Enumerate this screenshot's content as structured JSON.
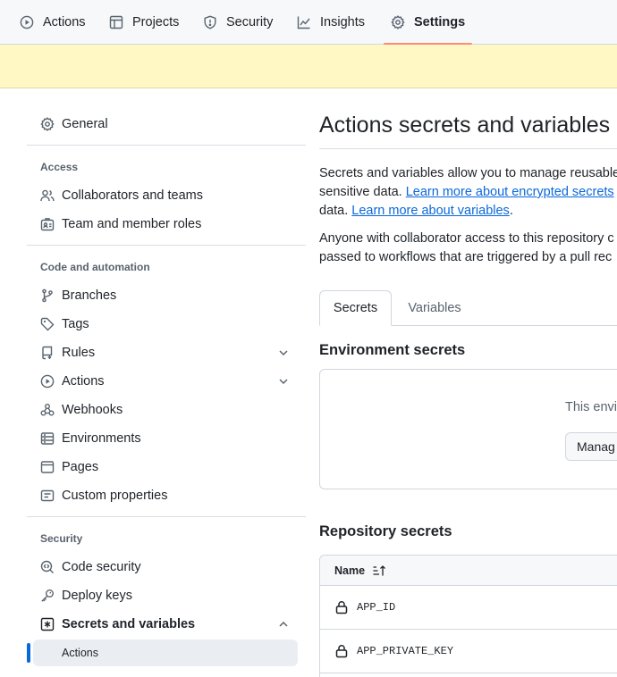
{
  "topnav": {
    "tabs": [
      {
        "label": "Actions",
        "icon": "play-icon"
      },
      {
        "label": "Projects",
        "icon": "table-icon"
      },
      {
        "label": "Security",
        "icon": "shield-icon"
      },
      {
        "label": "Insights",
        "icon": "graph-icon"
      },
      {
        "label": "Settings",
        "icon": "gear-icon",
        "active": true
      }
    ],
    "active_underline_color": "#fd8c73"
  },
  "banner": {
    "color": "#fff8c5"
  },
  "sidebar": {
    "general": "General",
    "access_heading": "Access",
    "access_items": [
      "Collaborators and teams",
      "Team and member roles"
    ],
    "code_heading": "Code and automation",
    "code_items": [
      "Branches",
      "Tags",
      "Rules",
      "Actions",
      "Webhooks",
      "Environments",
      "Pages",
      "Custom properties"
    ],
    "security_heading": "Security",
    "security_items": [
      "Code security",
      "Deploy keys",
      "Secrets and variables"
    ],
    "secrets_sub": [
      "Actions"
    ],
    "accent_color": "#0969da"
  },
  "main": {
    "title": "Actions secrets and variables",
    "intro": {
      "line1": "Secrets and variables allow you to manage reusable",
      "line2_pre": "sensitive data. ",
      "link1": "Learn more about encrypted secrets",
      "line3_pre": "data. ",
      "link2": "Learn more about variables",
      "line3_post": "."
    },
    "access_note": {
      "line1": "Anyone with collaborator access to this repository c",
      "line2": "passed to workflows that are triggered by a pull rec"
    },
    "tabs": [
      "Secrets",
      "Variables"
    ],
    "env_heading": "Environment secrets",
    "env_text": "This envi",
    "manage_button": "Manag",
    "repo_heading": "Repository secrets",
    "table": {
      "name_header": "Name",
      "rows": [
        "APP_ID",
        "APP_PRIVATE_KEY"
      ]
    }
  }
}
